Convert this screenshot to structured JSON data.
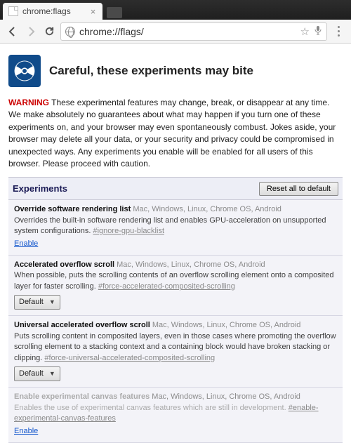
{
  "tab": {
    "title": "chrome:flags"
  },
  "omnibox": {
    "url": "chrome://flags/"
  },
  "header": {
    "title": "Careful, these experiments may bite"
  },
  "warning": {
    "label": "WARNING",
    "text": "These experimental features may change, break, or disappear at any time. We make absolutely no guarantees about what may happen if you turn one of these experiments on, and your browser may even spontaneously combust. Jokes aside, your browser may delete all your data, or your security and privacy could be compromised in unexpected ways. Any experiments you enable will be enabled for all users of this browser. Please proceed with caution."
  },
  "panel": {
    "title": "Experiments",
    "reset": "Reset all to default"
  },
  "experiments": [
    {
      "title": "Override software rendering list",
      "platforms": "Mac, Windows, Linux, Chrome OS, Android",
      "desc": "Overrides the built-in software rendering list and enables GPU-acceleration on unsupported system configurations.",
      "hash": "#ignore-gpu-blacklist",
      "action_type": "link",
      "action_label": "Enable"
    },
    {
      "title": "Accelerated overflow scroll",
      "platforms": "Mac, Windows, Linux, Chrome OS, Android",
      "desc": "When possible, puts the scrolling contents of an overflow scrolling element onto a composited layer for faster scrolling.",
      "hash": "#force-accelerated-composited-scrolling",
      "action_type": "select",
      "action_label": "Default"
    },
    {
      "title": "Universal accelerated overflow scroll",
      "platforms": "Mac, Windows, Linux, Chrome OS, Android",
      "desc": "Puts scrolling content in composited layers, even in those cases where promoting the overflow scrolling element to a stacking context and a containing block would have broken stacking or clipping.",
      "hash": "#force-universal-accelerated-composited-scrolling",
      "action_type": "select",
      "action_label": "Default"
    },
    {
      "title": "Enable experimental canvas features",
      "platforms": "Mac, Windows, Linux, Chrome OS, Android",
      "desc": "Enables the use of experimental canvas features which are still in development.",
      "hash": "#enable-experimental-canvas-features",
      "action_type": "link",
      "action_label": "Enable",
      "faded": true
    }
  ]
}
